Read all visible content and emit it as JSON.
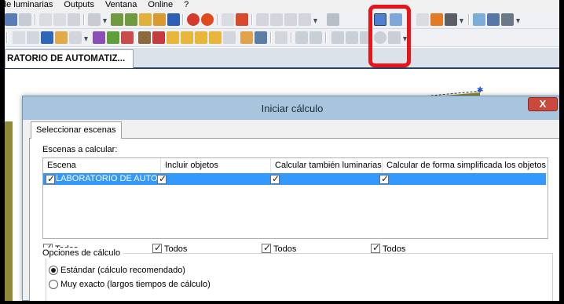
{
  "menu": {
    "items": [
      "de luminarias",
      "Outputs",
      "Ventana",
      "Online",
      "?"
    ]
  },
  "document_tab": {
    "label": "RATORIO DE AUTOMATIZ..."
  },
  "dialog": {
    "title": "Iniciar cálculo",
    "close_label": "X",
    "tab_label": "Seleccionar escenas",
    "scenes_label": "Escenas a calcular:",
    "columns": [
      "Escena",
      "Incluir objetos",
      "Calcular también luminarias",
      "Calcular de forma simplificada los objetos d..."
    ],
    "rows": [
      {
        "scene": "LABORATORIO DE AUTOMAT",
        "checked": true,
        "include_objects": true,
        "calc_luminaires": true,
        "simplified": true
      }
    ],
    "todos_labels": [
      "Todos",
      "Todos",
      "Todos",
      "Todos"
    ],
    "options_group_title": "Opciones de cálculo",
    "radio_standard_label": "Estándar (cálculo recomendado)",
    "radio_exact_label": "Muy exacto (largos tiempos de cálculo)",
    "selected_option": "standard"
  },
  "colors": {
    "highlight": "#e8141a",
    "selection": "#3399ff",
    "title_bar": "#a9c5de",
    "close_button": "#c94a3c"
  }
}
